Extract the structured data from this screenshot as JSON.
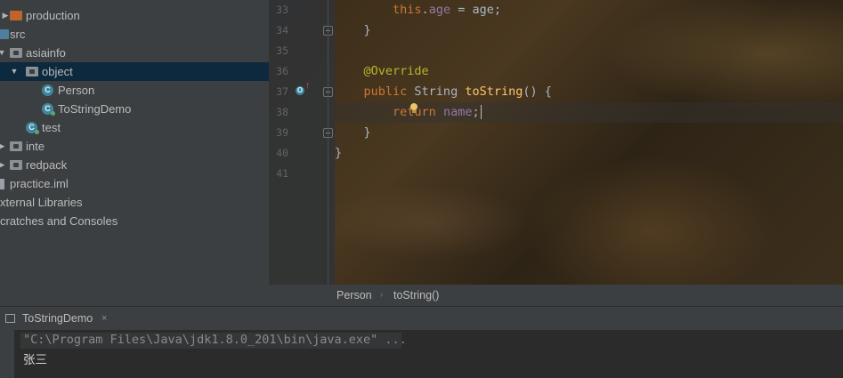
{
  "project_tree": {
    "items": [
      {
        "label": "production",
        "icon": "folder-icon-orange"
      },
      {
        "label": "src",
        "icon": "folder-icon-blue"
      },
      {
        "label": "asiainfo",
        "icon": "folder-icon"
      },
      {
        "label": "object",
        "icon": "folder-icon"
      },
      {
        "label": "Person",
        "icon": "class-icon"
      },
      {
        "label": "ToStringDemo",
        "icon": "class-icon"
      },
      {
        "label": "test",
        "icon": "class-icon"
      },
      {
        "label": "inte",
        "icon": "folder-icon"
      },
      {
        "label": "redpack",
        "icon": "folder-icon"
      },
      {
        "label": "practice.iml",
        "icon": "file-icon"
      },
      {
        "label": "xternal Libraries",
        "icon": ""
      },
      {
        "label": "cratches and Consoles",
        "icon": ""
      }
    ],
    "selected": "object"
  },
  "editor": {
    "line_numbers": [
      "33",
      "34",
      "35",
      "36",
      "37",
      "38",
      "39",
      "40",
      "41"
    ],
    "lines": {
      "l33": {
        "kw": "this",
        "dot": ".",
        "fld": "age",
        "rest": " = age;"
      },
      "l34": {
        "text": "}"
      },
      "l36": {
        "ann": "@Override"
      },
      "l37": {
        "kw": "public",
        "type": " String ",
        "fn": "toString",
        "rest": "() {"
      },
      "l38": {
        "kw": "return",
        "sp": " ",
        "fld": "name",
        "rest": ";"
      },
      "l39": {
        "text": "}"
      },
      "l40": {
        "text": "}"
      }
    },
    "colors": {
      "keyword": "#cc7832",
      "field": "#9876aa",
      "method": "#ffc66d",
      "annotation": "#bbb529",
      "text": "#a9b7c6"
    }
  },
  "breadcrumb": {
    "items": [
      "Person",
      "toString()"
    ],
    "separator": "›"
  },
  "run_panel": {
    "tab_label": "ToStringDemo",
    "tab_close": "×",
    "command": "\"C:\\Program Files\\Java\\jdk1.8.0_201\\bin\\java.exe\" ...",
    "output": "张三"
  }
}
